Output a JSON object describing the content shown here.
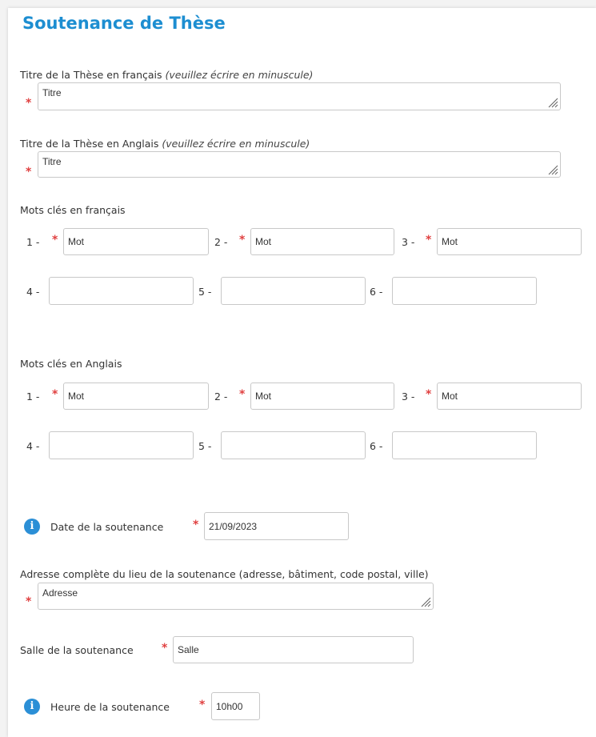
{
  "page": {
    "title": "Soutenance de Thèse"
  },
  "titre_fr": {
    "label": "Titre de la Thèse en français ",
    "hint": "(veuillez écrire en minuscule)",
    "value": "Titre"
  },
  "titre_en": {
    "label": "Titre de la Thèse en Anglais ",
    "hint": "(veuillez écrire en minuscule)",
    "value": "Titre"
  },
  "mots_fr": {
    "label": "Mots clés en français",
    "fields": [
      {
        "num": "1 -",
        "value": "Mot"
      },
      {
        "num": "2 -",
        "value": "Mot"
      },
      {
        "num": "3 -",
        "value": "Mot"
      },
      {
        "num": "4 -",
        "value": ""
      },
      {
        "num": "5 -",
        "value": ""
      },
      {
        "num": "6 -",
        "value": ""
      }
    ]
  },
  "mots_en": {
    "label": "Mots clés en Anglais",
    "fields": [
      {
        "num": "1 -",
        "value": "Mot"
      },
      {
        "num": "2 -",
        "value": "Mot"
      },
      {
        "num": "3 -",
        "value": "Mot"
      },
      {
        "num": "4 -",
        "value": ""
      },
      {
        "num": "5 -",
        "value": ""
      },
      {
        "num": "6 -",
        "value": ""
      }
    ]
  },
  "date": {
    "label": "Date de la soutenance",
    "value": "21/09/2023"
  },
  "adresse": {
    "label": "Adresse complète du lieu de la soutenance (adresse, bâtiment, code postal, ville)",
    "value": "Adresse"
  },
  "salle": {
    "label": "Salle de la soutenance",
    "value": "Salle"
  },
  "heure": {
    "label": "Heure de la soutenance",
    "value": "10h00"
  },
  "required_mark": "*",
  "info_glyph": "i",
  "colors": {
    "title": "#1d8ed1",
    "required": "#e04040",
    "info": "#2b8fd6"
  }
}
